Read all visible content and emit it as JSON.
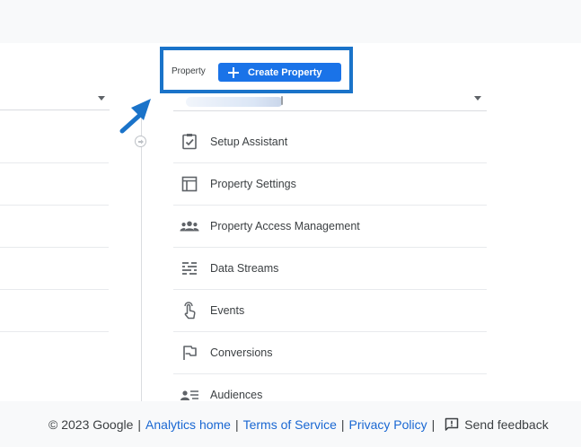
{
  "header": {
    "property_label": "Property",
    "create_property_button": "Create Property"
  },
  "property_menu": {
    "items": [
      {
        "label": "Setup Assistant",
        "icon": "clipboard-check-icon"
      },
      {
        "label": "Property Settings",
        "icon": "layout-icon"
      },
      {
        "label": "Property Access Management",
        "icon": "people-icon"
      },
      {
        "label": "Data Streams",
        "icon": "streams-icon"
      },
      {
        "label": "Events",
        "icon": "touch-icon"
      },
      {
        "label": "Conversions",
        "icon": "flag-icon"
      },
      {
        "label": "Audiences",
        "icon": "audience-icon"
      }
    ]
  },
  "footer": {
    "copyright": "© 2023 Google",
    "analytics_home": "Analytics home",
    "terms": "Terms of Service",
    "privacy": "Privacy Policy",
    "sep": "|",
    "feedback": "Send feedback"
  },
  "colors": {
    "accent": "#1a73e8",
    "annotation": "#1a73c9",
    "link": "#1967d2"
  }
}
